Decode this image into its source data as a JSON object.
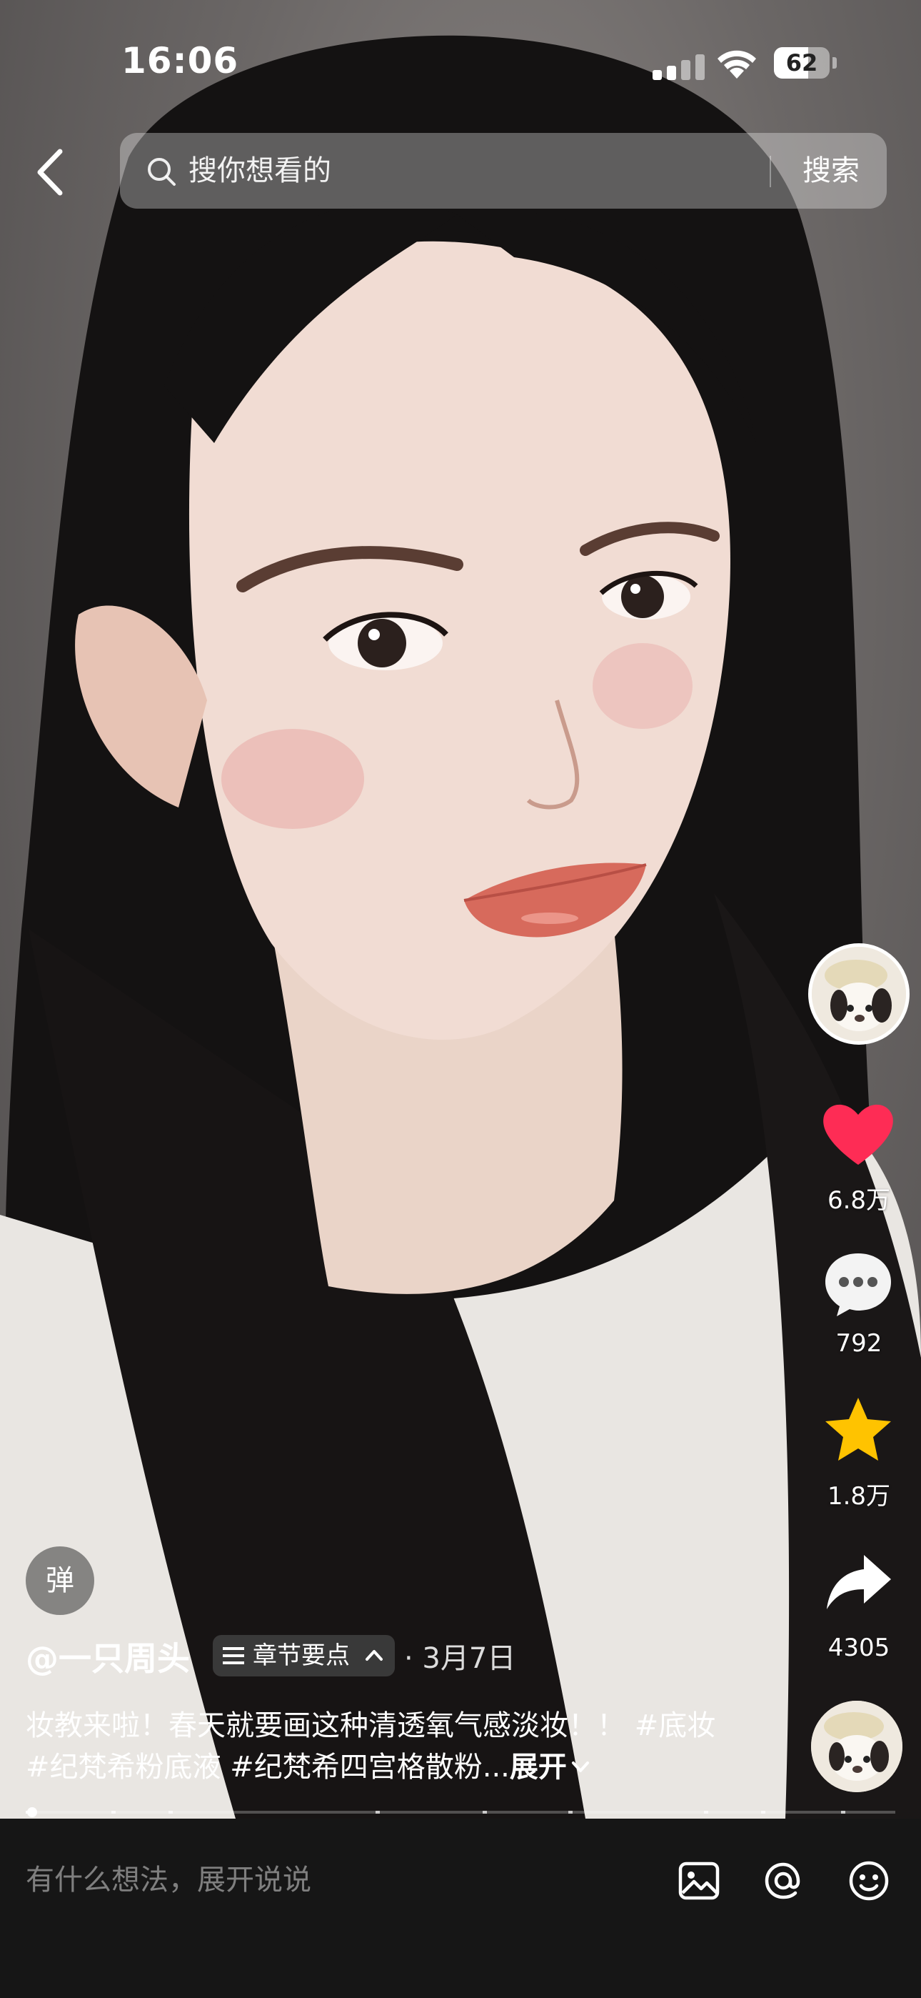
{
  "status_bar": {
    "time": "16:06",
    "battery": "62",
    "battery_level": 0.62
  },
  "search": {
    "placeholder": "搜你想看的",
    "button": "搜索"
  },
  "actions": {
    "likes": "6.8万",
    "comments": "792",
    "favorites": "1.8万",
    "shares": "4305"
  },
  "danmu_label": "弹",
  "post": {
    "author": "@一只周头",
    "chapter_label": "章节要点",
    "date": "· 3月7日",
    "description": "妆教来啦！春天就要画这种清透氧气感淡妆！！ #底妆 #纪梵希粉底液 #纪梵希四宫格散粉...",
    "expand_label": "展开"
  },
  "progress": {
    "played_fraction": 0.007
  },
  "comment_bar": {
    "placeholder": "有什么想法，展开说说"
  },
  "colors": {
    "like": "#FE2C55",
    "favorite": "#FFC300",
    "bottom_bar": "#161616"
  },
  "icons": [
    "back-icon",
    "search-icon",
    "heart-icon",
    "comment-icon",
    "star-icon",
    "share-icon",
    "image-icon",
    "at-icon",
    "emoji-icon",
    "list-icon",
    "chevron-up-icon",
    "chevron-down-icon"
  ]
}
